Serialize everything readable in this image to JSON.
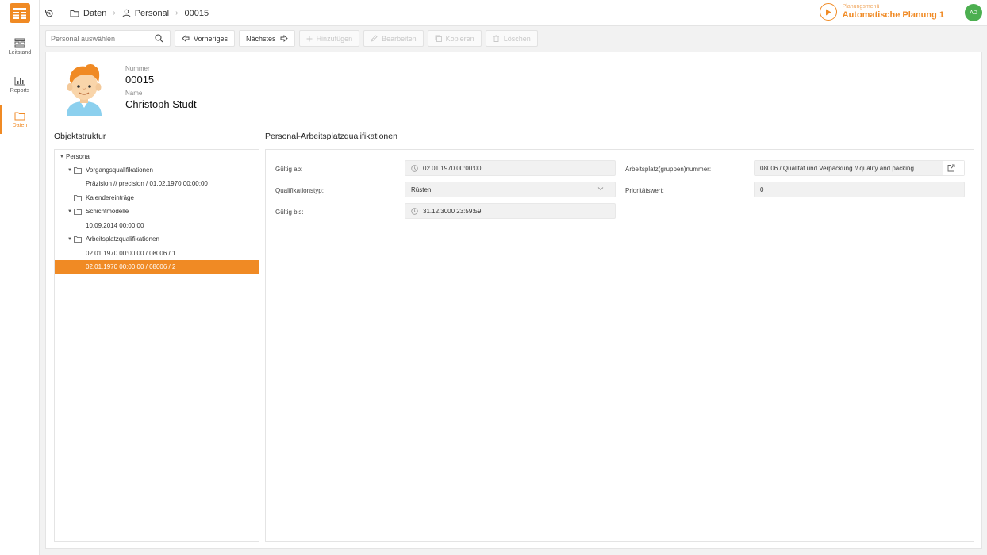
{
  "topbar": {
    "breadcrumb": [
      "Daten",
      "Personal",
      "00015"
    ],
    "plan_caption": "Planungsmenü",
    "plan_name": "Automatische Planung 1",
    "user_initials": "AD"
  },
  "rail": {
    "items": [
      {
        "label": "Leitstand",
        "icon": "control-center-icon"
      },
      {
        "label": "Reports",
        "icon": "bar-chart-icon"
      },
      {
        "label": "Daten",
        "icon": "folder-icon",
        "active": true
      }
    ]
  },
  "toolbar": {
    "search_placeholder": "Personal auswählen",
    "prev_label": "Vorheriges",
    "next_label": "Nächstes",
    "add_label": "Hinzufügen",
    "edit_label": "Bearbeiten",
    "copy_label": "Kopieren",
    "delete_label": "Löschen"
  },
  "person": {
    "number_label": "Nummer",
    "number": "00015",
    "name_label": "Name",
    "name": "Christoph Studt"
  },
  "structure": {
    "title": "Objektstruktur",
    "nodes": [
      {
        "label": "Personal",
        "level": 0,
        "expanded": true,
        "folder": false
      },
      {
        "label": "Vorgangsqualifikationen",
        "level": 1,
        "expanded": true,
        "folder": true
      },
      {
        "label": "Präzision // precision / 01.02.1970 00:00:00",
        "level": 2,
        "folder": false
      },
      {
        "label": "Kalendereinträge",
        "level": 1,
        "expanded": false,
        "folder": true
      },
      {
        "label": "Schichtmodelle",
        "level": 1,
        "expanded": true,
        "folder": true
      },
      {
        "label": "10.09.2014 00:00:00",
        "level": 2,
        "folder": false
      },
      {
        "label": "Arbeitsplatzqualifikationen",
        "level": 1,
        "expanded": true,
        "folder": true
      },
      {
        "label": "02.01.1970 00:00:00 / 08006 / 1",
        "level": 2,
        "folder": false
      },
      {
        "label": "02.01.1970 00:00:00 / 08006 / 2",
        "level": 2,
        "folder": false,
        "selected": true
      }
    ]
  },
  "details": {
    "title": "Personal-Arbeitsplatzqualifikationen",
    "valid_from_label": "Gültig ab:",
    "valid_from": "02.01.1970 00:00:00",
    "qual_type_label": "Qualifikationstyp:",
    "qual_type": "Rüsten",
    "valid_to_label": "Gültig bis:",
    "valid_to": "31.12.3000 23:59:59",
    "workplace_label": "Arbeitsplatz(gruppen)nummer:",
    "workplace": "08006 / Qualität und Verpackung // quality and packing",
    "priority_label": "Prioritätswert:",
    "priority": "0"
  },
  "colors": {
    "accent": "#f08a24",
    "avatar": "#4caf50"
  }
}
